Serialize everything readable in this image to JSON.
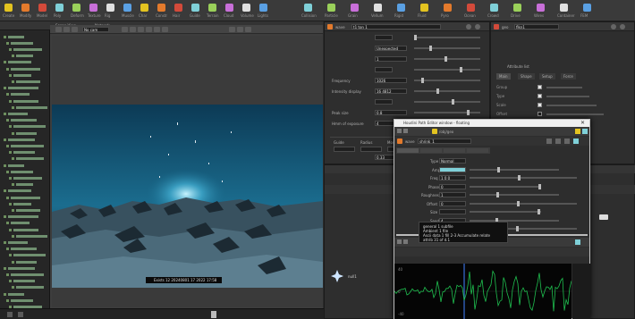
{
  "shelf": {
    "left_items": [
      "Create",
      "Modify",
      "Model",
      "Poly",
      "Deform",
      "Texture",
      "Rig",
      "Muscle",
      "Char",
      "Constr",
      "Hair",
      "Guide",
      "Terrain",
      "Cloud",
      "Volume",
      "Lights"
    ],
    "right_items": [
      "Collision",
      "Particle",
      "Grain",
      "Vellum",
      "Rigid",
      "Fluid",
      "Pyro",
      "Ocean",
      "Crowd",
      "Drive",
      "Wires",
      "Container",
      "FEM"
    ]
  },
  "viewport": {
    "tab_label": "Scene View",
    "tab2_label": "Network",
    "camera_label": "No cam",
    "frame_label": "47",
    "stamp": "Exists 12  20240801 17 2022 17:58"
  },
  "params_left": {
    "node_label": "wave",
    "node_name": "t1 ton 1",
    "rows": [
      {
        "label": "",
        "value": ""
      },
      {
        "label": "",
        "value": "Unexpected"
      },
      {
        "label": "",
        "value": "1"
      },
      {
        "label": "",
        "value": ""
      },
      {
        "label": "Frequency",
        "value": "1026"
      },
      {
        "label": "Intensity display",
        "value": "16 4812"
      },
      {
        "label": "",
        "value": ""
      },
      {
        "label": "Peak size",
        "value": "0.8"
      },
      {
        "label": "Hmm of exposure",
        "value": "4"
      }
    ],
    "section2": [
      "Guide",
      "Radius",
      "Mode",
      "Sim"
    ],
    "bottom_value": "0.33"
  },
  "params_right": {
    "node_label": "geo",
    "node_name": "flkn1",
    "section_title": "Attribute list",
    "tabs": [
      "Main",
      "Shape",
      "Setup",
      "Force"
    ],
    "checks": [
      true,
      true,
      true,
      false
    ],
    "rows": [
      "Group",
      "Type",
      "Scale",
      "Offset",
      "Seed",
      "Random Mode",
      "Tile"
    ]
  },
  "dialog": {
    "title": "Houdini Path Editor window - floating",
    "path_label": "/obj/geo",
    "node_label": "wave",
    "node_name": "shrink_1",
    "rows": [
      {
        "label": "Type",
        "value": "Normal"
      },
      {
        "label": "Amp",
        "value": ""
      },
      {
        "label": "Freq",
        "value": "1 0 0"
      },
      {
        "label": "Phase",
        "value": "0"
      },
      {
        "label": "Roughness",
        "value": "1"
      },
      {
        "label": "Offset",
        "value": "0"
      },
      {
        "label": "Size",
        "value": ""
      },
      {
        "label": "Seed",
        "value": "4"
      },
      {
        "label": "Clamp",
        "value": ""
      }
    ],
    "tooltip_lines": [
      "general 1 subfile",
      "Ambient 1 file",
      "Ascii data 1 fill 2-3 Accumulate relate",
      "attrib 31 of d.1"
    ]
  },
  "graph": {
    "y_labels": [
      "40",
      "0",
      "-40"
    ]
  },
  "mini_node": {
    "label": "null1"
  },
  "colors": {
    "accent_cyan": "#7fd0d8",
    "accent_yellow": "#e3c320",
    "graph_line": "#1fbf4f",
    "graph_marker": "#3a6fd8"
  }
}
